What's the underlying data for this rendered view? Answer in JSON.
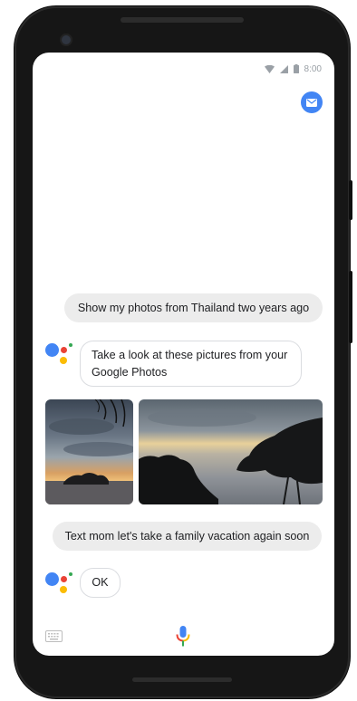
{
  "status_bar": {
    "time": "8:00",
    "icons": [
      "wifi-icon",
      "signal-icon",
      "battery-icon"
    ]
  },
  "header": {
    "action_icon": "email-icon",
    "accent_color": "#4285f4"
  },
  "conversation": [
    {
      "role": "user",
      "text": "Show my photos from Thailand two years ago"
    },
    {
      "role": "assistant",
      "lines": [
        "Take a look at these pictures from your",
        "Google Photos"
      ]
    },
    {
      "role": "photos",
      "items": [
        "sunset-island-photo",
        "sunset-tree-photo"
      ]
    },
    {
      "role": "user",
      "text": "Text mom let's take a family vacation again soon"
    },
    {
      "role": "assistant",
      "text": "OK"
    }
  ],
  "bottom_bar": {
    "left_icon": "keyboard-icon",
    "center_icon": "mic-icon"
  },
  "colors": {
    "assistant_blue": "#4285f4",
    "assistant_red": "#ea4335",
    "assistant_yellow": "#fbbc05",
    "assistant_green": "#34a853",
    "user_bubble": "#ececec"
  }
}
